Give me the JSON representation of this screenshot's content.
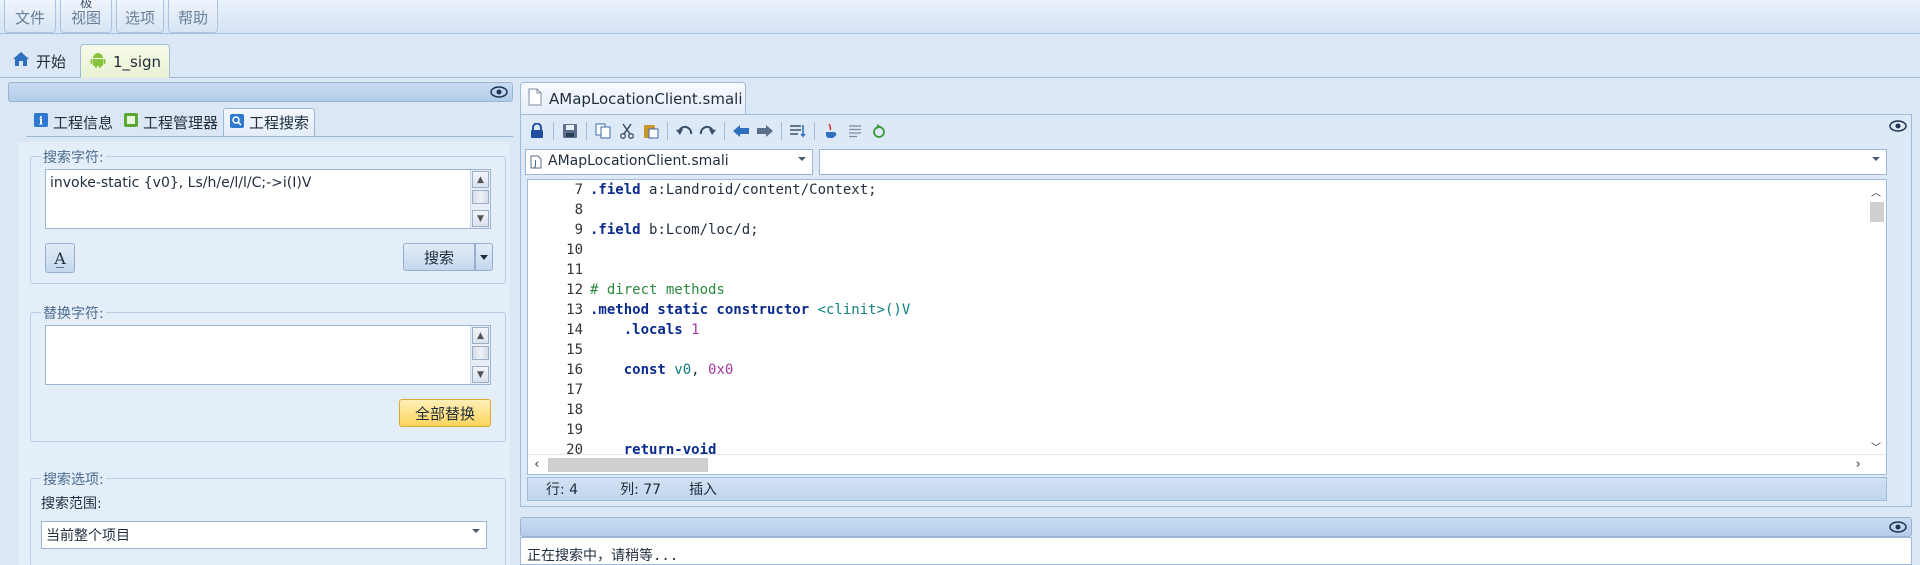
{
  "menu": {
    "items": [
      "文件",
      "视图",
      "选项",
      "帮助"
    ],
    "view_top_glyph": "极"
  },
  "doc_tabs": [
    {
      "label": "开始",
      "icon": "home-icon"
    },
    {
      "label": "1_sign",
      "icon": "android-icon"
    }
  ],
  "left_panel": {
    "tabs": [
      {
        "label": "工程信息",
        "icon": "info-icon"
      },
      {
        "label": "工程管理器",
        "icon": "project-manager-icon"
      },
      {
        "label": "工程搜索",
        "icon": "search-panel-icon"
      }
    ],
    "search": {
      "legend": "搜索字符:",
      "value": "invoke-static {v0}, Ls/h/e/l/l/C;->i(I)V",
      "button": "搜索"
    },
    "replace": {
      "legend": "替换字符:",
      "value": "",
      "button": "全部替换"
    },
    "options": {
      "legend": "搜索选项:",
      "scope_label": "搜索范围:",
      "scope_value": "当前整个项目"
    }
  },
  "editor": {
    "file_tab": "AMapLocationClient.smali",
    "file_combo": "AMapLocationClient.smali",
    "member_combo": "",
    "lines": [
      {
        "n": "7",
        "parts": [
          {
            "c": "k",
            "t": ".field "
          },
          {
            "c": "n",
            "t": "a:Landroid/content/Context;"
          }
        ]
      },
      {
        "n": "8",
        "parts": []
      },
      {
        "n": "9",
        "parts": [
          {
            "c": "k",
            "t": ".field "
          },
          {
            "c": "n",
            "t": "b:Lcom/loc/d;"
          }
        ]
      },
      {
        "n": "10",
        "parts": []
      },
      {
        "n": "11",
        "parts": []
      },
      {
        "n": "12",
        "parts": [
          {
            "c": "g",
            "t": "# direct methods"
          }
        ]
      },
      {
        "n": "13",
        "parts": [
          {
            "c": "k",
            "t": ".method static constructor "
          },
          {
            "c": "t",
            "t": "<clinit>()V"
          }
        ]
      },
      {
        "n": "14",
        "parts": [
          {
            "c": "k",
            "t": "    .locals "
          },
          {
            "c": "p",
            "t": "1"
          }
        ]
      },
      {
        "n": "15",
        "parts": []
      },
      {
        "n": "16",
        "parts": [
          {
            "c": "k",
            "t": "    const "
          },
          {
            "c": "t",
            "t": "v0"
          },
          {
            "c": "n",
            "t": ", "
          },
          {
            "c": "p",
            "t": "0x0"
          }
        ]
      },
      {
        "n": "17",
        "parts": []
      },
      {
        "n": "18",
        "parts": []
      },
      {
        "n": "19",
        "parts": []
      },
      {
        "n": "20",
        "parts": [
          {
            "c": "k",
            "t": "    return-void"
          }
        ]
      }
    ],
    "status": {
      "row": "行: 4",
      "col": "列: 77",
      "mode": "插入"
    }
  },
  "output": {
    "text": "正在搜索中，请稍等..."
  },
  "colors": {
    "keyword": "#0a2a8c",
    "comment": "#2b8a3e",
    "register": "#0f7f7f",
    "literal": "#a33aa3"
  }
}
